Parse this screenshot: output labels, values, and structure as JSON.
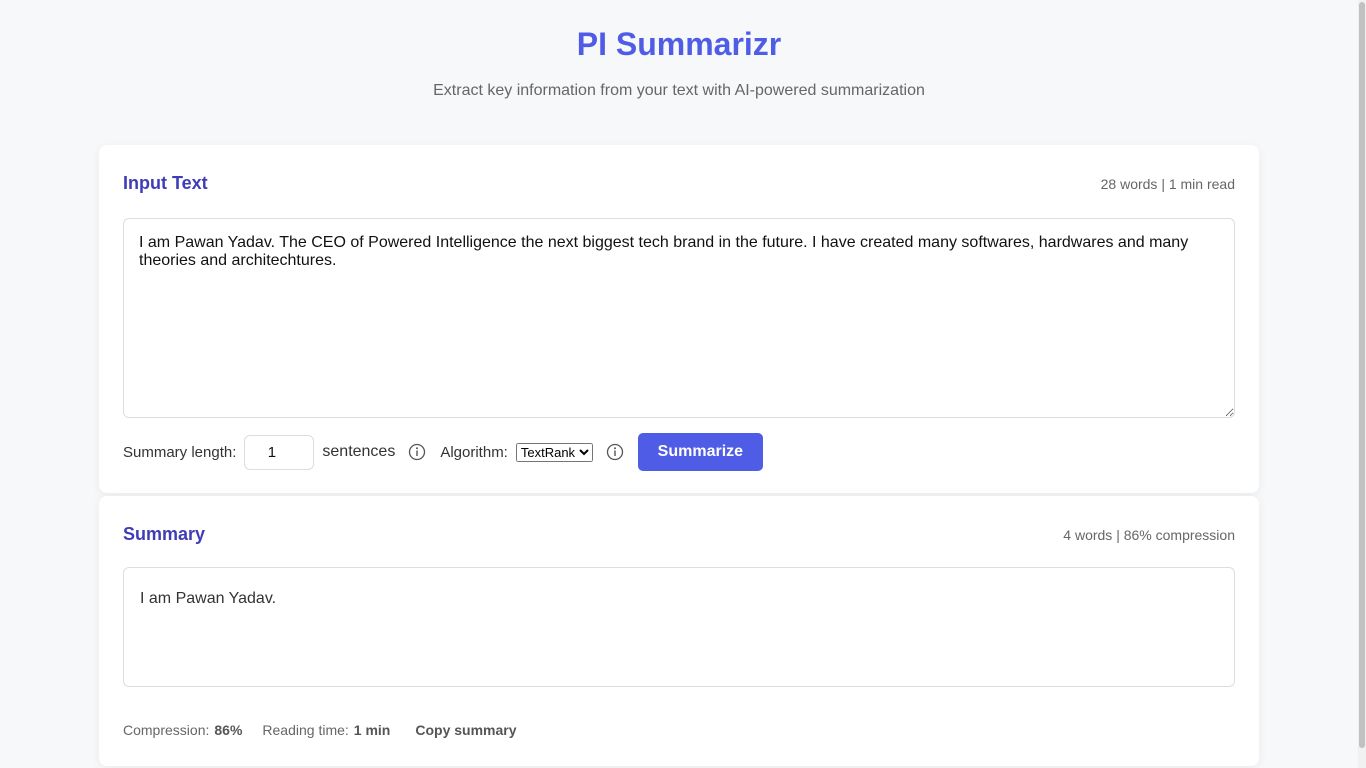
{
  "header": {
    "title": "PI Summarizr",
    "subtitle": "Extract key information from your text with AI-powered summarization"
  },
  "input_card": {
    "title": "Input Text",
    "meta": "28 words | 1 min read",
    "text": "I am Pawan Yadav. The CEO of Powered Intelligence the next biggest tech brand in the future. I have created many softwares, hardwares and many theories and architechtures.",
    "controls": {
      "length_label": "Summary length:",
      "length_value": "1",
      "unit_label": "sentences",
      "algorithm_label": "Algorithm:",
      "algorithm_selected": "TextRank",
      "summarize_label": "Summarize"
    }
  },
  "summary_card": {
    "title": "Summary",
    "meta": "4 words | 86% compression",
    "text": "I am Pawan Yadav.",
    "stats": {
      "compression_label": "Compression:",
      "compression_value": "86%",
      "reading_label": "Reading time:",
      "reading_value": "1 min",
      "copy_label": "Copy summary"
    }
  },
  "icons": {
    "length_info": "info-icon",
    "algorithm_info": "info-icon"
  },
  "colors": {
    "accent": "#4f5ce6",
    "heading": "#3f3cb8",
    "background": "#f7f8fa"
  }
}
